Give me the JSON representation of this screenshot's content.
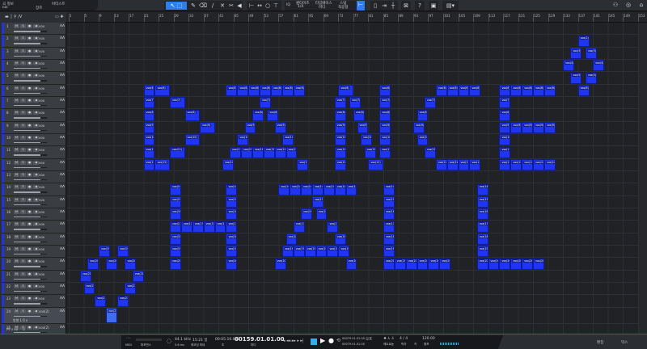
{
  "song": {
    "title": "곡 정보",
    "sub": "장르",
    "field": "Edit",
    "artist": "아티스트"
  },
  "toolbar": {
    "tools": [
      "pointer-icon",
      "range-icon",
      "pencil-icon",
      "eraser-icon",
      "paint-icon",
      "mute-icon",
      "split-icon",
      "listen-icon"
    ],
    "quantize_label": "퀀타이즈",
    "quantize_value": "1/4",
    "timebase_label": "타임베이스",
    "timebase_value": "마디",
    "snap_label": "스냅",
    "snap_value": "적응형",
    "help": "?"
  },
  "ruler": {
    "first_bar": 1,
    "last_bar": 153,
    "step": 4
  },
  "accent": "#2d7ff0",
  "clip_color": "#1f35f2",
  "tracks": [
    {
      "num": "1",
      "name": "vox",
      "clip_label": "vox(1)",
      "clips": []
    },
    {
      "num": "2",
      "name": "vox",
      "clip_label": "vox(2)",
      "clips": [
        [
          137,
          3
        ]
      ]
    },
    {
      "num": "3",
      "name": "vox",
      "clip_label": "vox(3)",
      "clips": [
        [
          135,
          3
        ],
        [
          139,
          3
        ]
      ]
    },
    {
      "num": "4",
      "name": "vox",
      "clip_label": "vox(4)",
      "clips": [
        [
          133,
          3
        ],
        [
          141,
          3
        ]
      ]
    },
    {
      "num": "5",
      "name": "vox",
      "clip_label": "vox(5)",
      "clips": [
        [
          135,
          3
        ],
        [
          139,
          3
        ]
      ]
    },
    {
      "num": "6",
      "name": "vox",
      "clip_label": "vox(6)",
      "clips": [
        [
          21,
          3
        ],
        [
          24,
          4
        ],
        [
          43,
          3
        ],
        [
          46,
          3
        ],
        [
          49,
          3
        ],
        [
          52,
          3
        ],
        [
          55,
          3
        ],
        [
          58,
          3
        ],
        [
          61,
          3
        ],
        [
          73,
          4
        ],
        [
          84,
          3
        ],
        [
          99,
          3
        ],
        [
          102,
          3
        ],
        [
          105,
          3
        ],
        [
          108,
          3
        ],
        [
          116,
          3
        ],
        [
          119,
          3
        ],
        [
          122,
          3
        ],
        [
          125,
          3
        ],
        [
          128,
          3
        ],
        [
          137,
          3
        ]
      ]
    },
    {
      "num": "7",
      "name": "vox",
      "clip_label": "vox(7)",
      "clips": [
        [
          21,
          3
        ],
        [
          28,
          4
        ],
        [
          52,
          3
        ],
        [
          72,
          3
        ],
        [
          76,
          3
        ],
        [
          84,
          3
        ],
        [
          96,
          3
        ],
        [
          116,
          3
        ]
      ]
    },
    {
      "num": "8",
      "name": "vox",
      "clip_label": "vox(8)",
      "clips": [
        [
          21,
          3
        ],
        [
          32,
          4
        ],
        [
          50,
          3
        ],
        [
          54,
          3
        ],
        [
          72,
          3
        ],
        [
          77,
          3
        ],
        [
          84,
          3
        ],
        [
          94,
          3
        ],
        [
          116,
          3
        ]
      ]
    },
    {
      "num": "9",
      "name": "vox",
      "clip_label": "vox(9)",
      "clips": [
        [
          21,
          3
        ],
        [
          36,
          4
        ],
        [
          48,
          3
        ],
        [
          56,
          3
        ],
        [
          72,
          3
        ],
        [
          78,
          3
        ],
        [
          84,
          3
        ],
        [
          93,
          3
        ],
        [
          116,
          3
        ],
        [
          119,
          3
        ],
        [
          122,
          3
        ],
        [
          125,
          3
        ],
        [
          128,
          3
        ]
      ]
    },
    {
      "num": "10",
      "name": "vox",
      "clip_label": "vox(10)",
      "clips": [
        [
          21,
          3
        ],
        [
          32,
          4
        ],
        [
          46,
          3
        ],
        [
          58,
          3
        ],
        [
          72,
          3
        ],
        [
          79,
          3
        ],
        [
          84,
          3
        ],
        [
          94,
          3
        ],
        [
          116,
          3
        ]
      ]
    },
    {
      "num": "11",
      "name": "vox",
      "clip_label": "vox(11)",
      "clips": [
        [
          21,
          3
        ],
        [
          28,
          4
        ],
        [
          44,
          3
        ],
        [
          47,
          3
        ],
        [
          50,
          3
        ],
        [
          53,
          3
        ],
        [
          56,
          3
        ],
        [
          59,
          3
        ],
        [
          72,
          3
        ],
        [
          80,
          3
        ],
        [
          84,
          3
        ],
        [
          96,
          3
        ],
        [
          116,
          3
        ]
      ]
    },
    {
      "num": "12",
      "name": "vox",
      "clip_label": "vox(12)",
      "clips": [
        [
          21,
          3
        ],
        [
          24,
          4
        ],
        [
          42,
          3
        ],
        [
          62,
          3
        ],
        [
          72,
          3
        ],
        [
          81,
          4
        ],
        [
          99,
          3
        ],
        [
          102,
          3
        ],
        [
          105,
          3
        ],
        [
          108,
          3
        ],
        [
          116,
          3
        ],
        [
          119,
          3
        ],
        [
          122,
          3
        ],
        [
          125,
          3
        ],
        [
          128,
          3
        ]
      ]
    },
    {
      "num": "13",
      "name": "vox",
      "clip_label": "vox(13)",
      "clips": []
    },
    {
      "num": "14",
      "name": "vox",
      "clip_label": "vox(14)",
      "clips": [
        [
          28,
          3
        ],
        [
          43,
          3
        ],
        [
          57,
          3
        ],
        [
          60,
          3
        ],
        [
          63,
          3
        ],
        [
          66,
          3
        ],
        [
          69,
          3
        ],
        [
          72,
          3
        ],
        [
          75,
          3
        ],
        [
          85,
          3
        ],
        [
          110,
          3
        ]
      ]
    },
    {
      "num": "15",
      "name": "vox",
      "clip_label": "vox(15)",
      "clips": [
        [
          28,
          3
        ],
        [
          43,
          3
        ],
        [
          66,
          3
        ],
        [
          85,
          3
        ],
        [
          110,
          3
        ]
      ]
    },
    {
      "num": "16",
      "name": "vox",
      "clip_label": "vox(16)",
      "clips": [
        [
          28,
          3
        ],
        [
          43,
          3
        ],
        [
          63,
          3
        ],
        [
          67,
          3
        ],
        [
          85,
          3
        ],
        [
          110,
          3
        ]
      ]
    },
    {
      "num": "17",
      "name": "vox",
      "clip_label": "vox(17)",
      "clips": [
        [
          28,
          3
        ],
        [
          31,
          3
        ],
        [
          34,
          3
        ],
        [
          37,
          3
        ],
        [
          40,
          3
        ],
        [
          43,
          3
        ],
        [
          61,
          3
        ],
        [
          70,
          3
        ],
        [
          85,
          3
        ],
        [
          110,
          3
        ]
      ]
    },
    {
      "num": "18",
      "name": "vox",
      "clip_label": "vox(18)",
      "clips": [
        [
          28,
          3
        ],
        [
          43,
          3
        ],
        [
          59,
          3
        ],
        [
          72,
          3
        ],
        [
          85,
          3
        ],
        [
          110,
          3
        ]
      ]
    },
    {
      "num": "19",
      "name": "vox",
      "clip_label": "vox(19)",
      "clips": [
        [
          9,
          3
        ],
        [
          14,
          3
        ],
        [
          28,
          3
        ],
        [
          43,
          3
        ],
        [
          58,
          3
        ],
        [
          61,
          3
        ],
        [
          64,
          3
        ],
        [
          67,
          3
        ],
        [
          70,
          3
        ],
        [
          73,
          3
        ],
        [
          85,
          3
        ],
        [
          110,
          3
        ]
      ]
    },
    {
      "num": "20",
      "name": "vox",
      "clip_label": "vox(20)",
      "clips": [
        [
          6,
          3
        ],
        [
          11,
          3
        ],
        [
          16,
          3
        ],
        [
          28,
          3
        ],
        [
          43,
          3
        ],
        [
          56,
          3
        ],
        [
          75,
          3
        ],
        [
          85,
          3
        ],
        [
          88,
          3
        ],
        [
          91,
          3
        ],
        [
          94,
          3
        ],
        [
          97,
          3
        ],
        [
          100,
          3
        ],
        [
          110,
          3
        ],
        [
          113,
          3
        ],
        [
          116,
          3
        ],
        [
          119,
          3
        ],
        [
          122,
          3
        ],
        [
          125,
          3
        ]
      ]
    },
    {
      "num": "21",
      "name": "vox",
      "clip_label": "vox(21)",
      "clips": [
        [
          4,
          3
        ],
        [
          18,
          3
        ]
      ]
    },
    {
      "num": "22",
      "name": "vox",
      "clip_label": "vox(22)",
      "clips": [
        [
          5,
          3
        ],
        [
          16,
          3
        ]
      ]
    },
    {
      "num": "23",
      "name": "vox",
      "clip_label": "vox(23)",
      "clips": [
        [
          8,
          3
        ],
        [
          14,
          3
        ]
      ]
    },
    {
      "num": "24",
      "name": "vox(2)",
      "clip_label": "vox(2)",
      "clips": [
        [
          11,
          3
        ]
      ],
      "selected": true,
      "extra": "방향 L    0 s"
    },
    {
      "num": "25",
      "name": "vox(2)",
      "clip_label": "vox(2)",
      "clips": []
    }
  ],
  "transport": {
    "midi": "MIDI",
    "performance": "퍼포먼스",
    "sample_rate": "44.1 kHz",
    "latency": "5.6 ms",
    "record_time": "15:21 일",
    "record_label": "레코딩 최대",
    "time": "00:05:16.000",
    "time_unit": "초",
    "position": "00159.01.01.00",
    "position_unit": "마디",
    "loop_start": "00079.01.01.00",
    "loop_end": "00079.01.01.00",
    "off": "오프",
    "metronome": "메트로놈",
    "signature": "4 / 4",
    "signature_label": "박자",
    "key_label": "키",
    "tempo": "120.00",
    "tempo_label": "템포",
    "edit": "편집",
    "mix": "믹스"
  }
}
